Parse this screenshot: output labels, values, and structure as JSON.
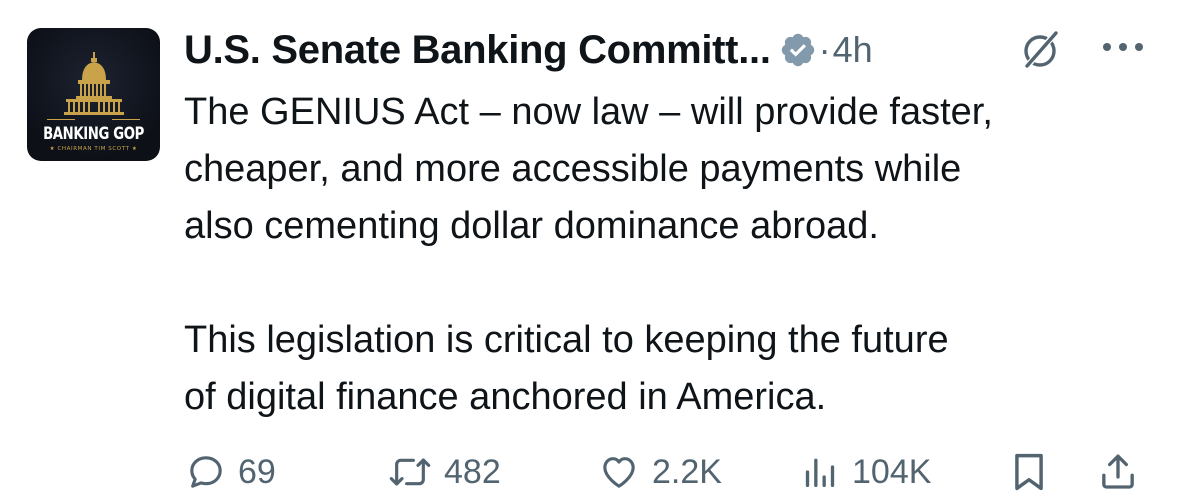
{
  "avatar": {
    "brand_text": "BANKING GOP",
    "sub_text": "★ CHAIRMAN TIM SCOTT ★",
    "icon": "capitol-dome-icon"
  },
  "header": {
    "display_name": "U.S. Senate Banking Committ...",
    "verified_icon": "verified-badge-icon",
    "separator": "·",
    "timestamp": "4h",
    "grok_icon": "grok-slash-icon",
    "more_icon": "more-dots-icon"
  },
  "tweet": {
    "paragraph_1": "The GENIUS Act – now law – will provide faster,\ncheaper, and more accessible payments while\nalso cementing dollar dominance abroad.",
    "paragraph_2": "This legislation is critical to keeping the future\nof digital finance anchored in America."
  },
  "actions": {
    "reply": {
      "icon": "reply-icon",
      "count": "69"
    },
    "repost": {
      "icon": "repost-icon",
      "count": "482"
    },
    "like": {
      "icon": "heart-icon",
      "count": "2.2K"
    },
    "views": {
      "icon": "views-chart-icon",
      "count": "104K"
    },
    "bookmark": {
      "icon": "bookmark-icon"
    },
    "share": {
      "icon": "share-icon"
    }
  },
  "colors": {
    "text_primary": "#0f1419",
    "text_secondary": "#536471",
    "avatar_bg": "#0d1017",
    "avatar_gold": "#c9a24a",
    "verified_badge": "#829aab"
  }
}
